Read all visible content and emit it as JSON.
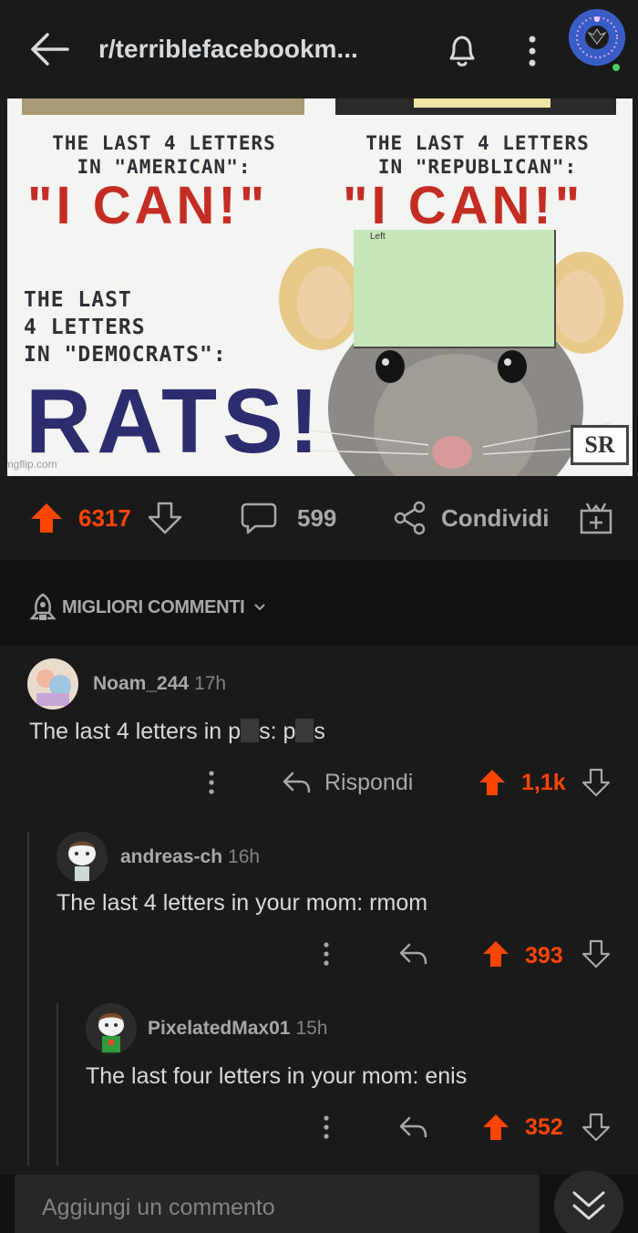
{
  "header": {
    "subreddit": "r/terriblefacebookm...",
    "back_icon": "arrow-left-icon",
    "bell_icon": "bell-icon",
    "more_icon": "more-vertical-icon"
  },
  "meme": {
    "left_caption": "THE LAST 4 LETTERS\nIN \"AMERICAN\":",
    "left_punch": "\"I CAN!\"",
    "right_caption": "THE LAST 4 LETTERS\nIN \"REPUBLICAN\":",
    "right_punch": "\"I CAN!\"",
    "bottom_caption": "THE LAST\n4 LETTERS\nIN \"DEMOCRATS\":",
    "bottom_punch": "RATS!",
    "sticky_note": "Left",
    "logo": "SR",
    "watermark": "imgflip.com"
  },
  "actions": {
    "upvotes": "6317",
    "comments": "599",
    "share_label": "Condividi"
  },
  "sort": {
    "label": "MIGLIORI COMMENTI"
  },
  "comments": [
    {
      "user": "Noam_244",
      "time": "17h",
      "body_parts": [
        "The last 4 letters in p",
        "s: p",
        "s"
      ],
      "reply_label": "Rispondi",
      "votes": "1,1k"
    },
    {
      "user": "andreas-ch",
      "time": "16h",
      "body": "The last 4 letters in your mom: rmom",
      "votes": "393"
    },
    {
      "user": "PixelatedMax01",
      "time": "15h",
      "body": "The last four letters in your mom: enis",
      "votes": "352"
    }
  ],
  "composer": {
    "placeholder": "Aggiungi un commento"
  },
  "colors": {
    "accent": "#ff4500",
    "background": "#1a1a1b",
    "text": "#d7dadc"
  }
}
